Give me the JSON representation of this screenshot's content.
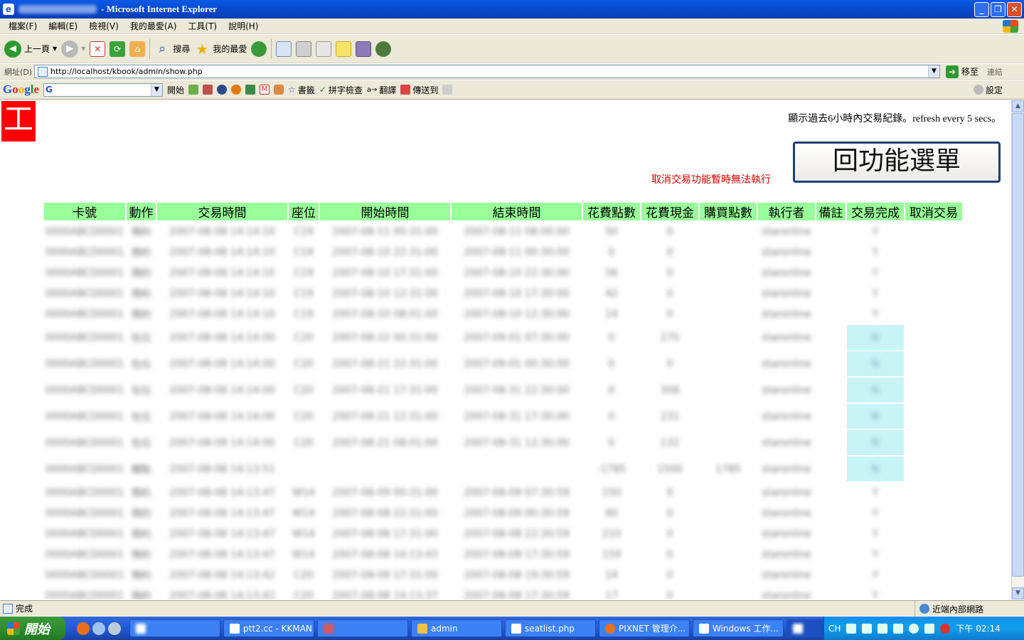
{
  "window": {
    "title": "- Microsoft Internet Explorer",
    "buttons": [
      "_",
      "❐",
      "✕"
    ]
  },
  "menubar": [
    "檔案(F)",
    "編輯(E)",
    "檢視(V)",
    "我的最愛(A)",
    "工具(T)",
    "說明(H)"
  ],
  "toolbar": {
    "back_label": "上一頁",
    "search_label": "搜尋",
    "favorites_label": "我的最愛"
  },
  "address": {
    "label": "網址(D)",
    "url": "http://localhost/kbook/admin/show.php",
    "go_label": "移至",
    "links_label": "連結"
  },
  "google_bar": {
    "logo": "Google",
    "search_prefix": "G",
    "start_label": "開始",
    "bookmarks_label": "書籤",
    "spellcheck_label": "拼字檢查",
    "translate_label": "翻譯",
    "sendto_label": "傳送到",
    "settings_label": "設定"
  },
  "page": {
    "logo_char": "工",
    "info_text": "顯示過去6小時內交易紀錄。refresh every 5 secs。",
    "menu_button": "回功能選單",
    "warning": "取消交易功能暫時無法執行"
  },
  "table": {
    "headers": [
      "卡號",
      "動作",
      "交易時間",
      "座位",
      "開始時間",
      "結束時間",
      "花費點數",
      "花費現金",
      "購買點數",
      "執行者",
      "備註",
      "交易完成",
      "取消交易"
    ],
    "rows": [
      {
        "card": "0000ABCD0001",
        "action": "預約",
        "time": "2007-08-08 14:14:10",
        "seat": "C19",
        "start": "2007-08-11 00:31:00",
        "end": "2007-08-11 08:00:00",
        "points": "50",
        "cash": "0",
        "buy": "",
        "operator": "staronline",
        "note": "",
        "done": "Y",
        "tall": false,
        "n": false
      },
      {
        "card": "0000ABCD0001",
        "action": "預約",
        "time": "2007-08-08 14:14:10",
        "seat": "C19",
        "start": "2007-08-10 22:31:00",
        "end": "2007-08-11 00:30:00",
        "points": "0",
        "cash": "0",
        "buy": "",
        "operator": "staronline",
        "note": "",
        "done": "Y",
        "tall": false,
        "n": false
      },
      {
        "card": "0000ABCD0001",
        "action": "預約",
        "time": "2007-08-08 14:14:10",
        "seat": "C19",
        "start": "2007-08-10 17:31:00",
        "end": "2007-08-10 22:30:00",
        "points": "56",
        "cash": "0",
        "buy": "",
        "operator": "staronline",
        "note": "",
        "done": "Y",
        "tall": false,
        "n": false
      },
      {
        "card": "0000ABCD0001",
        "action": "預約",
        "time": "2007-08-08 14:14:10",
        "seat": "C19",
        "start": "2007-08-10 12:31:00",
        "end": "2007-08-10 17:30:00",
        "points": "42",
        "cash": "0",
        "buy": "",
        "operator": "staronline",
        "note": "",
        "done": "Y",
        "tall": false,
        "n": false
      },
      {
        "card": "0000ABCD0001",
        "action": "預約",
        "time": "2007-08-08 14:14:10",
        "seat": "C19",
        "start": "2007-08-10 08:01:00",
        "end": "2007-08-10 12:30:00",
        "points": "24",
        "cash": "0",
        "buy": "",
        "operator": "staronline",
        "note": "",
        "done": "Y",
        "tall": false,
        "n": false
      },
      {
        "card": "0000ABCD0001",
        "action": "包位",
        "time": "2007-08-08 14:14:00",
        "seat": "C20",
        "start": "2007-08-22 00:31:00",
        "end": "2007-09-01 07:30:00",
        "points": "0",
        "cash": "275",
        "buy": "",
        "operator": "staronline",
        "note": "",
        "done": "N",
        "tall": true,
        "n": true
      },
      {
        "card": "0000ABCD0001",
        "action": "包位",
        "time": "2007-08-08 14:14:00",
        "seat": "C20",
        "start": "2007-08-21 22:31:00",
        "end": "2007-09-01 00:30:00",
        "points": "0",
        "cash": "0",
        "buy": "",
        "operator": "staronline",
        "note": "",
        "done": "N",
        "tall": true,
        "n": true
      },
      {
        "card": "0000ABCD0001",
        "action": "包位",
        "time": "2007-08-08 14:14:00",
        "seat": "C20",
        "start": "2007-08-21 17:31:00",
        "end": "2007-08-31 22:30:00",
        "points": "0",
        "cash": "308",
        "buy": "",
        "operator": "staronline",
        "note": "",
        "done": "N",
        "tall": true,
        "n": true
      },
      {
        "card": "0000ABCD0001",
        "action": "包位",
        "time": "2007-08-08 14:14:00",
        "seat": "C20",
        "start": "2007-08-21 12:31:00",
        "end": "2007-08-31 17:30:00",
        "points": "0",
        "cash": "231",
        "buy": "",
        "operator": "staronline",
        "note": "",
        "done": "N",
        "tall": true,
        "n": true
      },
      {
        "card": "0000ABCD0001",
        "action": "包位",
        "time": "2007-08-08 14:14:00",
        "seat": "C20",
        "start": "2007-08-21 08:01:00",
        "end": "2007-08-31 12:30:00",
        "points": "0",
        "cash": "132",
        "buy": "",
        "operator": "staronline",
        "note": "",
        "done": "N",
        "tall": true,
        "n": true
      },
      {
        "card": "0000ABCD0001",
        "action": "購點",
        "time": "2007-08-08 14:13:51",
        "seat": "",
        "start": "",
        "end": "",
        "points": "-1785",
        "cash": "1500",
        "buy": "1785",
        "operator": "staronline",
        "note": "",
        "done": "N",
        "tall": true,
        "n": true
      },
      {
        "card": "0000ABCD0001",
        "action": "預約",
        "time": "2007-08-08 14:13:47",
        "seat": "W14",
        "start": "2007-08-09 00:31:00",
        "end": "2007-08-09 07:30:59",
        "points": "150",
        "cash": "0",
        "buy": "",
        "operator": "staronline",
        "note": "",
        "done": "Y",
        "tall": false,
        "n": false
      },
      {
        "card": "0000ABCD0001",
        "action": "預約",
        "time": "2007-08-08 14:13:47",
        "seat": "W14",
        "start": "2007-08-08 22:31:00",
        "end": "2007-08-09 00:30:59",
        "points": "60",
        "cash": "0",
        "buy": "",
        "operator": "staronline",
        "note": "",
        "done": "Y",
        "tall": false,
        "n": false
      },
      {
        "card": "0000ABCD0001",
        "action": "預約",
        "time": "2007-08-08 14:13:47",
        "seat": "W14",
        "start": "2007-08-08 17:31:00",
        "end": "2007-08-08 22:30:59",
        "points": "210",
        "cash": "0",
        "buy": "",
        "operator": "staronline",
        "note": "",
        "done": "Y",
        "tall": false,
        "n": false
      },
      {
        "card": "0000ABCD0001",
        "action": "預約",
        "time": "2007-08-08 14:13:47",
        "seat": "W14",
        "start": "2007-08-08 14:13:43",
        "end": "2007-08-08 17:30:59",
        "points": "159",
        "cash": "0",
        "buy": "",
        "operator": "staronline",
        "note": "",
        "done": "Y",
        "tall": false,
        "n": false
      },
      {
        "card": "0000ABCD0001",
        "action": "預約",
        "time": "2007-08-08 14:13:42",
        "seat": "C20",
        "start": "2007-08-08 17:31:00",
        "end": "2007-08-08 19:30:59",
        "points": "24",
        "cash": "0",
        "buy": "",
        "operator": "staronline",
        "note": "",
        "done": "Y",
        "tall": false,
        "n": false
      },
      {
        "card": "0000ABCD0001",
        "action": "預約",
        "time": "2007-08-08 14:13:42",
        "seat": "C20",
        "start": "2007-08-08 14:13:37",
        "end": "2007-08-08 17:30:59",
        "points": "17",
        "cash": "0",
        "buy": "",
        "operator": "staronline",
        "note": "",
        "done": "Y",
        "tall": false,
        "n": false
      }
    ]
  },
  "statusbar": {
    "status": "完成",
    "zone": "近端內部網路"
  },
  "taskbar": {
    "start_label": "開始",
    "tasks": [
      "",
      "ptt2.cc - KKMAN",
      "",
      "admin",
      "seatlist.php",
      "PIXNET 管理介...",
      "Windows 工作...",
      ""
    ],
    "tray_lang": "CH",
    "clock": "下午 02:14"
  },
  "colors": {
    "header_bg": "#99ff99",
    "logo_bg": "#ff0000",
    "warning": "#d00000",
    "pending_cell": "#c8f4f6"
  }
}
